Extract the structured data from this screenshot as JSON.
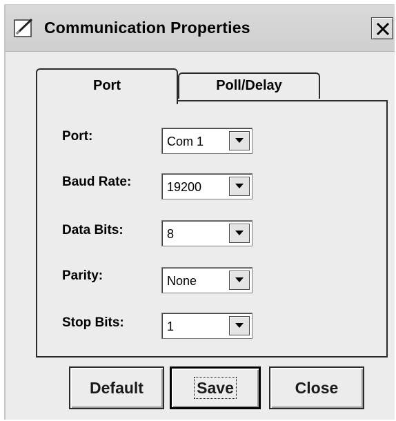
{
  "window": {
    "title": "Communication Properties",
    "icon": "edit-pencil-icon"
  },
  "tabs": [
    {
      "label": "Port",
      "selected": true
    },
    {
      "label": "Poll/Delay",
      "selected": false
    }
  ],
  "fields": [
    {
      "label": "Port:",
      "value": "Com 1"
    },
    {
      "label": "Baud Rate:",
      "value": "19200"
    },
    {
      "label": "Data Bits:",
      "value": "8"
    },
    {
      "label": "Parity:",
      "value": "None"
    },
    {
      "label": "Stop Bits:",
      "value": "1"
    }
  ],
  "buttons": {
    "default_label": "Default",
    "save_label": "Save",
    "close_label": "Close"
  }
}
